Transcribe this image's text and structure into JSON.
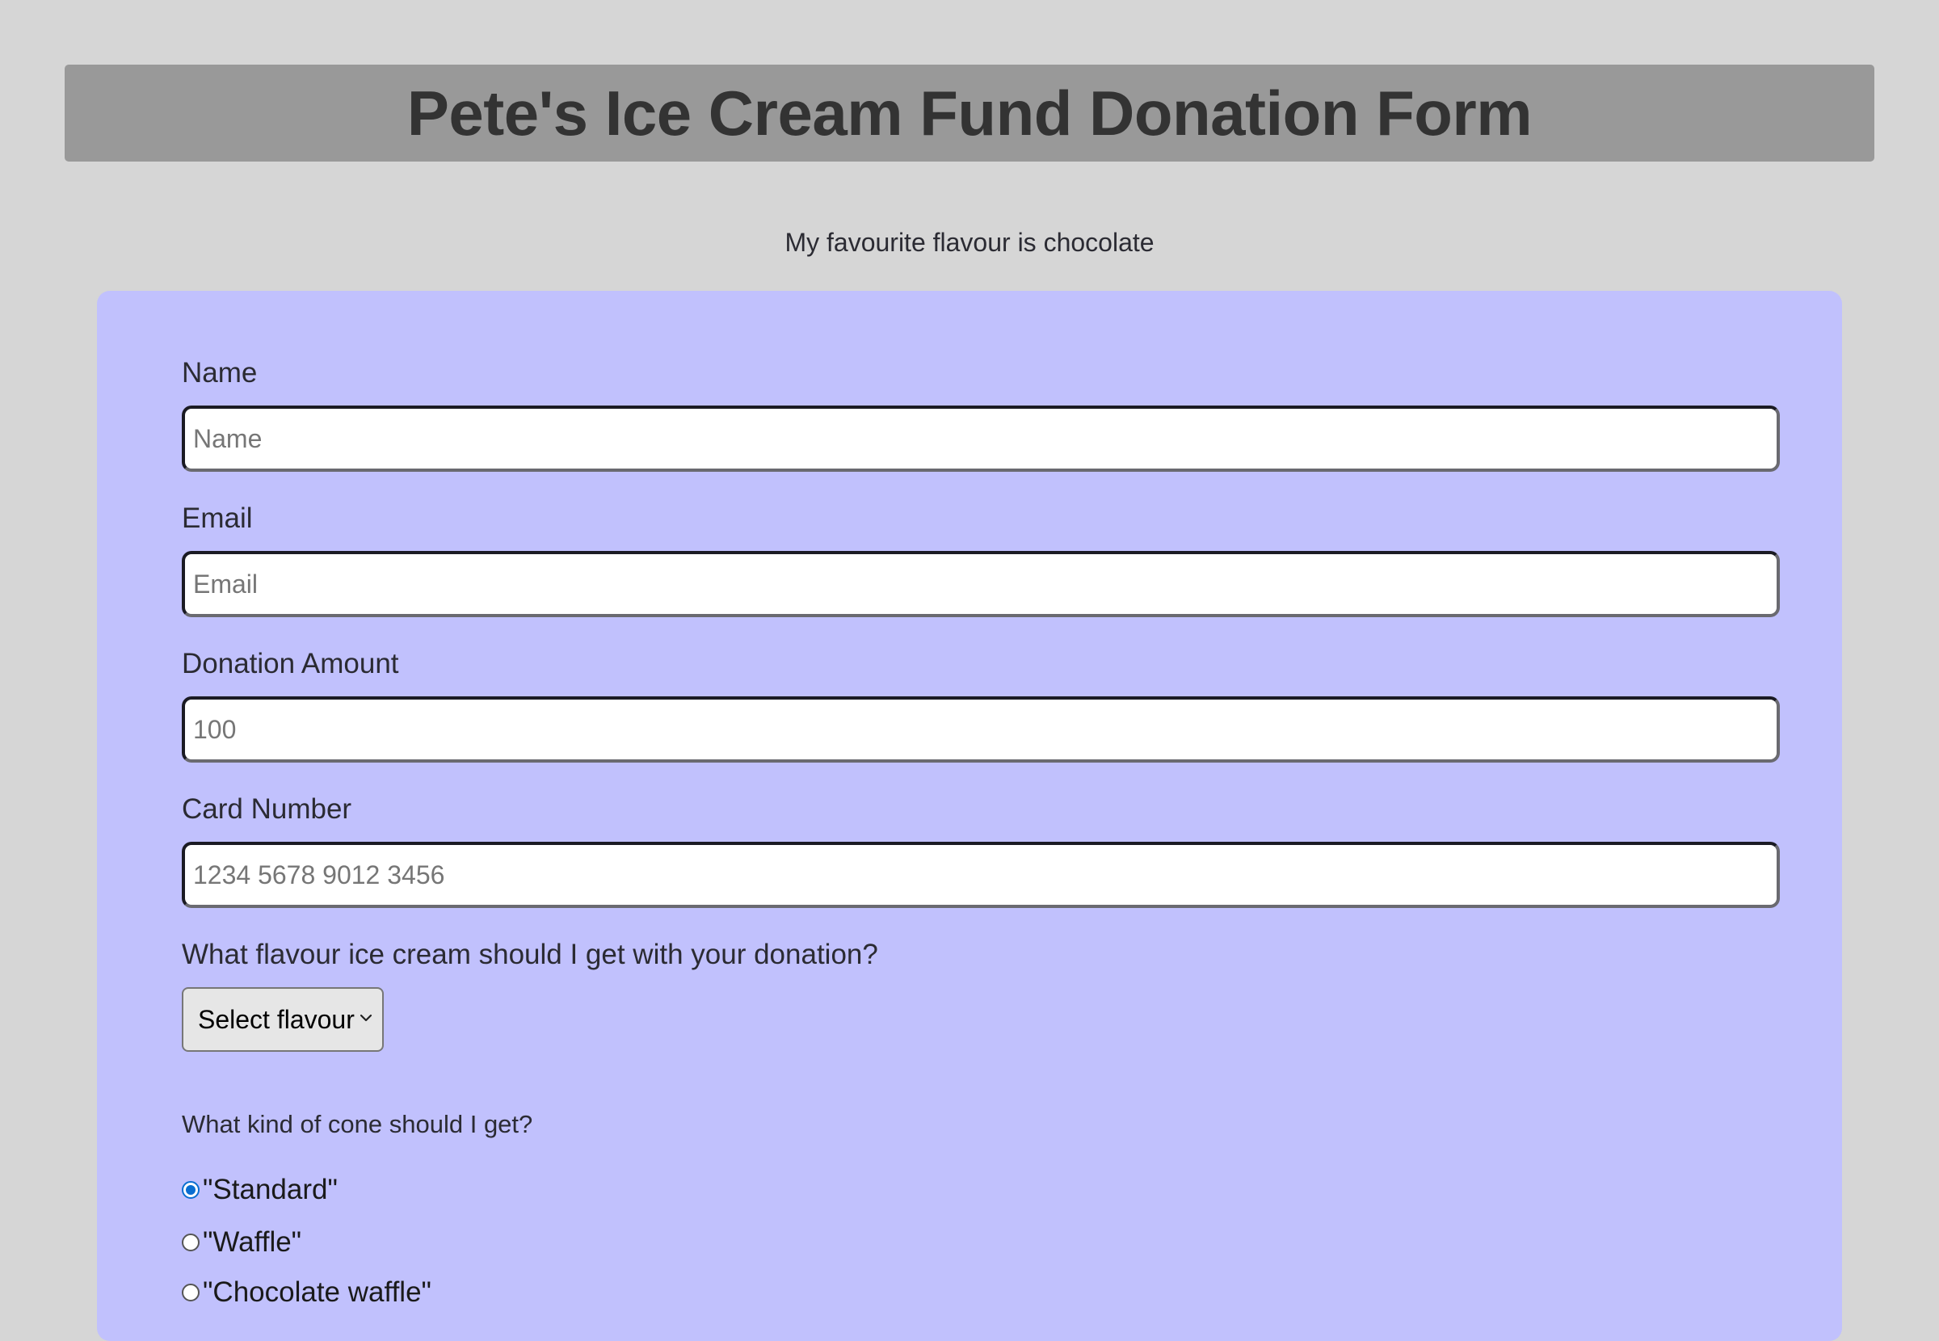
{
  "header": {
    "title": "Pete's Ice Cream Fund Donation Form"
  },
  "subtitle": "My favourite flavour is chocolate",
  "form": {
    "name": {
      "label": "Name",
      "placeholder": "Name",
      "value": ""
    },
    "email": {
      "label": "Email",
      "placeholder": "Email",
      "value": ""
    },
    "donation": {
      "label": "Donation Amount",
      "placeholder": "100",
      "value": ""
    },
    "card": {
      "label": "Card Number",
      "placeholder": "1234 5678 9012 3456",
      "value": ""
    },
    "flavour": {
      "label": "What flavour ice cream should I get with your donation?",
      "selected": "Select flavour",
      "icon": "chevron-down-icon"
    },
    "cone": {
      "question": "What kind of cone should I get?",
      "options": [
        {
          "label": "\"Standard\"",
          "checked": true
        },
        {
          "label": "\"Waffle\"",
          "checked": false
        },
        {
          "label": "\"Chocolate waffle\"",
          "checked": false
        }
      ]
    }
  },
  "colors": {
    "page_background": "#d6d6d6",
    "title_bar": "#999999",
    "form_background": "#c1c1fd",
    "radio_accent": "#0a6ed1"
  }
}
